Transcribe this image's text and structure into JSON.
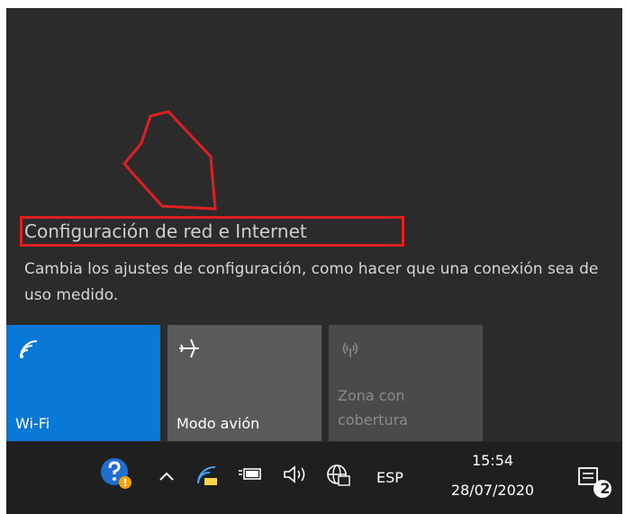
{
  "network_link": {
    "title": "Configuración de red e Internet",
    "description": "Cambia los ajustes de configuración, como hacer que una conexión sea de uso medido."
  },
  "quick_actions": [
    {
      "label": "Wi-Fi",
      "icon": "wifi-icon",
      "state": "on"
    },
    {
      "label": "Modo avión",
      "icon": "airplane-icon",
      "state": "off"
    },
    {
      "label": "Zona con cobertura",
      "icon": "hotspot-icon",
      "state": "disabled"
    }
  ],
  "taskbar": {
    "language": "ESP",
    "time": "15:54",
    "date": "28/07/2020",
    "notification_count": "2",
    "tray_icons": [
      "help-icon",
      "chevron-up-icon",
      "wifi-tray-icon",
      "battery-icon",
      "volume-icon",
      "globe-icon"
    ]
  },
  "colors": {
    "accent": "#0a78d6",
    "highlight": "#e02020",
    "flyout_bg": "#2b2b2b",
    "taskbar_bg": "#1f1f1f"
  }
}
